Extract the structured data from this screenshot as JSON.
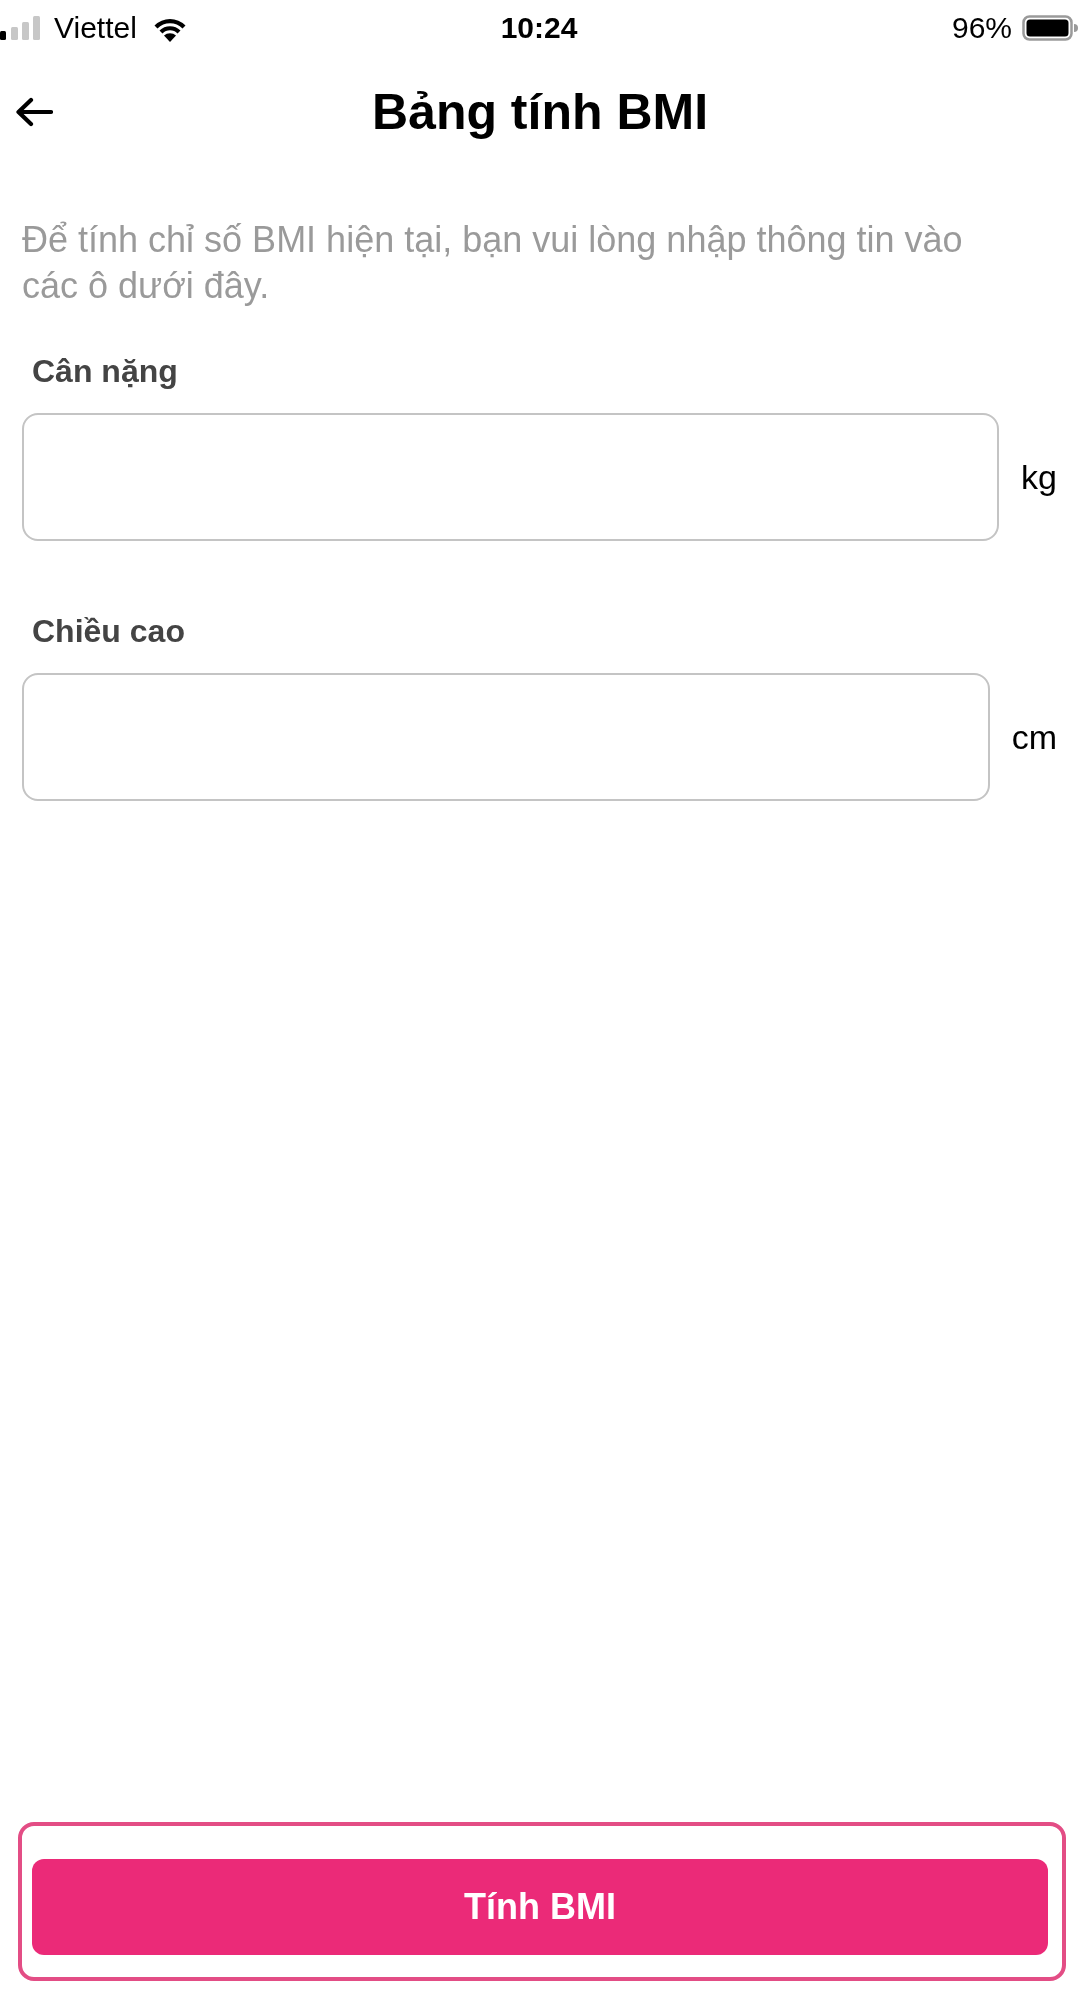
{
  "status_bar": {
    "carrier": "Viettel",
    "time": "10:24",
    "battery": "96%"
  },
  "header": {
    "title": "Bảng tính BMI"
  },
  "intro": "Để tính chỉ số BMI hiện tại, bạn vui lòng nhập thông tin vào các ô dưới đây.",
  "fields": [
    {
      "label": "Cân nặng",
      "unit": "kg"
    },
    {
      "label": "Chiều cao",
      "unit": "cm"
    }
  ],
  "submit_button": {
    "label": "Tính BMI",
    "highlighted": true
  }
}
